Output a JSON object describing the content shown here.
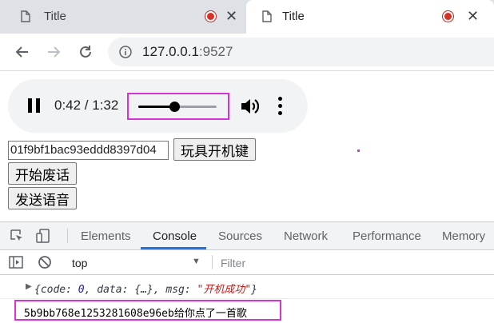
{
  "browser": {
    "tabs": [
      {
        "title": "Title",
        "active": false
      },
      {
        "title": "Title",
        "active": true
      }
    ],
    "address": {
      "host": "127.0.0.1",
      "port": ":9527"
    }
  },
  "player": {
    "state": "playing",
    "current_time": "0:42",
    "duration": "1:32",
    "time_text": "0:42 / 1:32",
    "progress_fraction": 0.46
  },
  "form": {
    "id_value": "01f9bf1bac93eddd8397d04",
    "toy_button": "玩具开机键",
    "start_button": "开始废话",
    "send_button": "发送语音"
  },
  "devtools": {
    "tabs": [
      "Elements",
      "Console",
      "Sources",
      "Network",
      "Performance",
      "Memory"
    ],
    "active_tab": "Console",
    "context": "top",
    "filter_placeholder": "Filter",
    "log": {
      "prefix": "{code: ",
      "code": "0",
      "middle": ", data: {…}, msg: ",
      "msg": "\"开机成功\"",
      "suffix": "}"
    },
    "log2": "5b9bb768e1253281608e96eb给你点了一首歌"
  },
  "colors": {
    "highlight": "#d335d3",
    "accent": "#1a73e8"
  }
}
